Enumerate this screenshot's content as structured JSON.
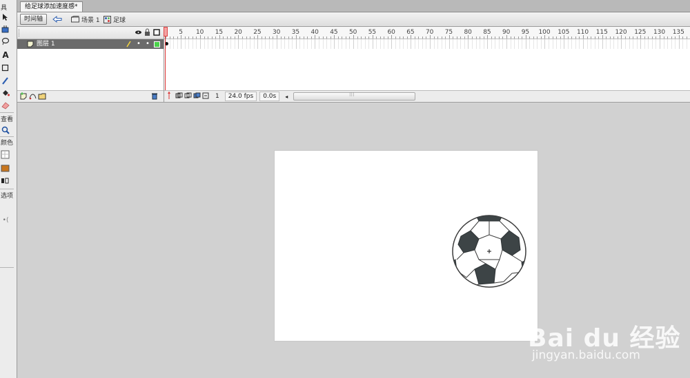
{
  "toolbar": {
    "labels": {
      "view": "查看",
      "color": "颜色",
      "options": "选项"
    }
  },
  "document": {
    "tab_title": "给足球添加速度感*"
  },
  "editbar": {
    "timeline_button": "时间轴",
    "scene_label": "场景 1",
    "symbol_label": "足球"
  },
  "timeline": {
    "layer_name": "图层 1",
    "frame_numbers": [
      "1",
      "5",
      "10",
      "15",
      "20",
      "25",
      "30",
      "35",
      "40",
      "45",
      "50",
      "55",
      "60",
      "65",
      "70",
      "75",
      "80",
      "85",
      "90",
      "95",
      "100",
      "105",
      "110",
      "115",
      "120",
      "125",
      "130",
      "135"
    ],
    "current_frame": "1",
    "fps": "24.0 fps",
    "elapsed": "0.0s",
    "scroll_grip": "⁝⁝⁝"
  },
  "stage": {
    "background": "#ffffff",
    "ball_panel_color": "#3d4446"
  },
  "watermark": {
    "brand": "Bai du 经验",
    "url": "jingyan.baidu.com"
  }
}
